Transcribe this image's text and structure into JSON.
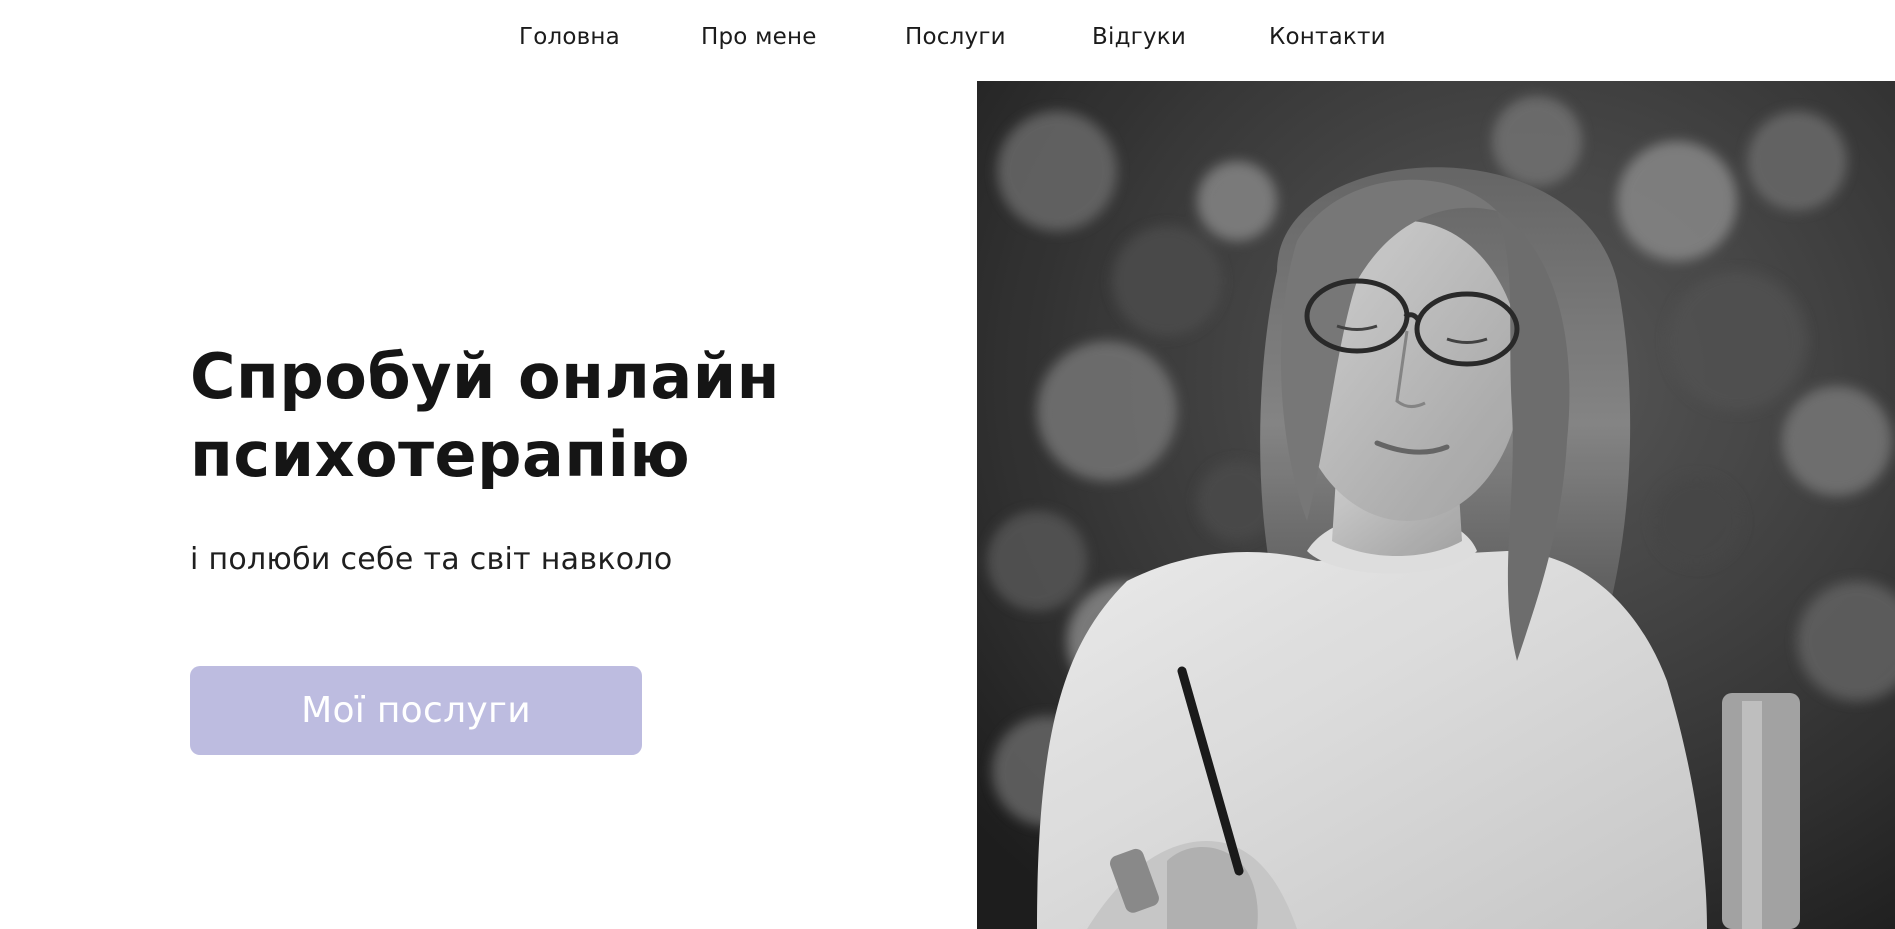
{
  "nav": {
    "items": [
      {
        "label": "Головна"
      },
      {
        "label": "Про мене"
      },
      {
        "label": "Послуги"
      },
      {
        "label": "Відгуки"
      },
      {
        "label": "Контакти"
      }
    ]
  },
  "hero": {
    "title_line1": "Спробуй онлайн",
    "title_line2": "психотерапію",
    "subtitle": "і полюби себе та світ навколо",
    "cta_label": "Мої послуги"
  },
  "colors": {
    "cta_background": "#bdbce0",
    "text": "#151515",
    "background": "#ffffff"
  },
  "photo": {
    "alt": "black-and-white portrait of a woman writing"
  }
}
